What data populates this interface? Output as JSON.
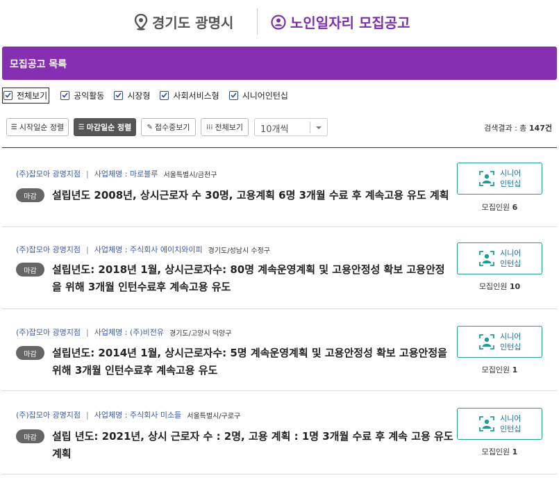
{
  "header": {
    "region": "경기도 광명시",
    "title": "노인일자리 모집공고",
    "region_icon": "location-pin-icon",
    "title_icon": "user-circle-icon"
  },
  "banner": {
    "title": "모집공고 목록"
  },
  "filters": [
    {
      "label": "전체보기",
      "checked": true
    },
    {
      "label": "공익활동",
      "checked": true
    },
    {
      "label": "시장형",
      "checked": true
    },
    {
      "label": "사회서비스형",
      "checked": true
    },
    {
      "label": "시니어인턴십",
      "checked": true
    }
  ],
  "controls": {
    "sort_start": "시작일순 정렬",
    "sort_deadline": "마감일순 정렬",
    "receiving": "접수중보기",
    "view_all": "전체보기",
    "page_size": "10개씩",
    "result_prefix": "검색결과 : 총",
    "result_count": "147건"
  },
  "items": [
    {
      "org": "(주)잡모아 광명지점",
      "company": "사업체명 : 마로블루",
      "location": "서울특별시/금천구",
      "status": "마감",
      "description": "설립년도 2008년, 상시근로자 수 30명, 고용계획 6명 3개월 수료 후 계속고용 유도 계획",
      "type_line1": "시니어",
      "type_line2": "인턴십",
      "recruit_label": "모집인원",
      "recruit_count": "6"
    },
    {
      "org": "(주)잡모아 광명지점",
      "company": "사업체명 : 주식회사 에이치와이피",
      "location": "경기도/성남시 수정구",
      "status": "마감",
      "description": "설립년도: 2018년 1월, 상시근로자수: 80명 계속운영계획 및 고용안정성 확보 고용안정을 위해 3개월 인턴수료후 계속고용 유도",
      "type_line1": "시니어",
      "type_line2": "인턴십",
      "recruit_label": "모집인원",
      "recruit_count": "10"
    },
    {
      "org": "(주)잡모아 광명지점",
      "company": "사업체명 : (주)비전유",
      "location": "경기도/고양시 덕양구",
      "status": "마감",
      "description": "설립년도: 2014년 1월, 상시근로자수: 5명 계속운영계획 및 고용안정성 확보 고용안정을 위해 3개월 인턴수료후 계속고용 유도",
      "type_line1": "시니어",
      "type_line2": "인턴십",
      "recruit_label": "모집인원",
      "recruit_count": "1"
    },
    {
      "org": "(주)잡모아 광명지점",
      "company": "사업체명 : 주식회사 미소들",
      "location": "서울특별시/구로구",
      "status": "마감",
      "description": "설립 년도: 2021년, 상시 근로자 수 : 2명, 고용 계획 : 1명 3개월 수료 후 계속 고용 유도 계획",
      "type_line1": "시니어",
      "type_line2": "인턴십",
      "recruit_label": "모집인원",
      "recruit_count": "1"
    }
  ],
  "colors": {
    "brand_purple": "#862fb3",
    "title_purple": "#7b2fa8",
    "teal": "#1a9e95",
    "link_blue": "#3b5aa8"
  }
}
